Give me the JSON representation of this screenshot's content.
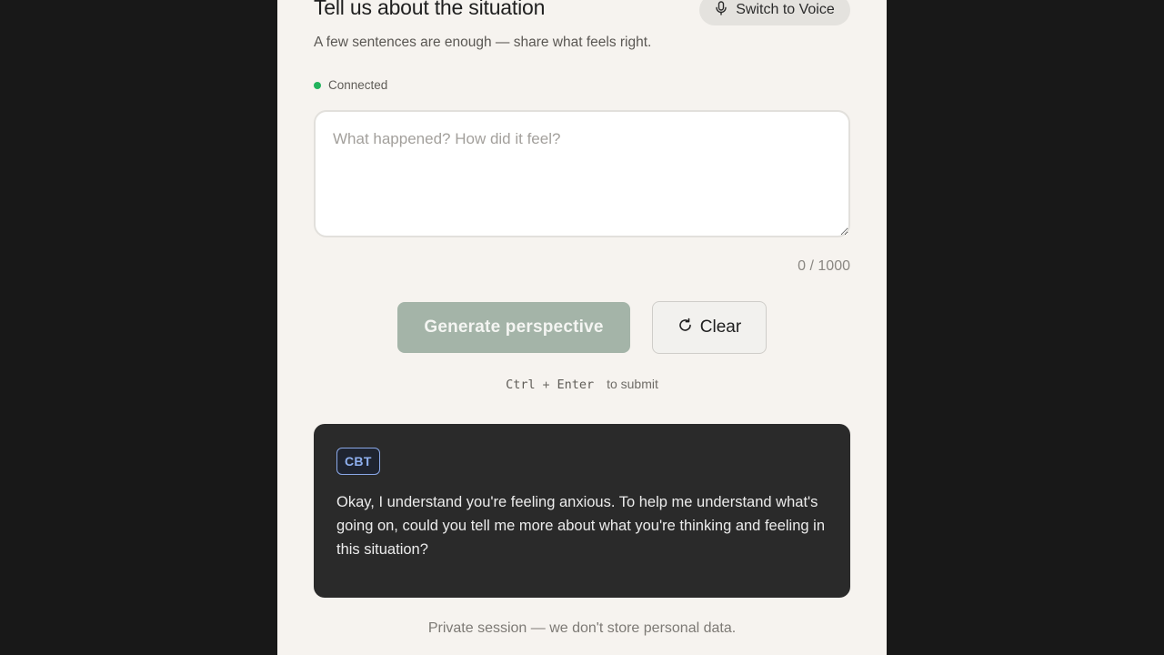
{
  "header": {
    "title": "Tell us about the situation",
    "voice_button_label": "Switch to Voice",
    "subtitle": "A few sentences are enough — share what feels right."
  },
  "status": {
    "label": "Connected",
    "color": "#22b35c"
  },
  "input": {
    "value": "",
    "placeholder": "What happened? How did it feel?",
    "counter": "0 / 1000"
  },
  "actions": {
    "generate_label": "Generate perspective",
    "clear_label": "Clear"
  },
  "shortcut": {
    "key1": "Ctrl",
    "plus": "+",
    "key2": "Enter",
    "suffix": "to submit"
  },
  "response": {
    "badge": "CBT",
    "text": "Okay, I understand you're feeling anxious. To help me understand what's going on, could you tell me more about what you're thinking and feeling in this situation?"
  },
  "footer": {
    "note": "Private session — we don't store personal data."
  },
  "icons": {
    "voice": "microphone-icon",
    "clear": "refresh-icon"
  },
  "colors": {
    "accent_muted": "#a4b4a8",
    "badge": "#8fb0f0",
    "card_bg": "#2a2a2a"
  }
}
